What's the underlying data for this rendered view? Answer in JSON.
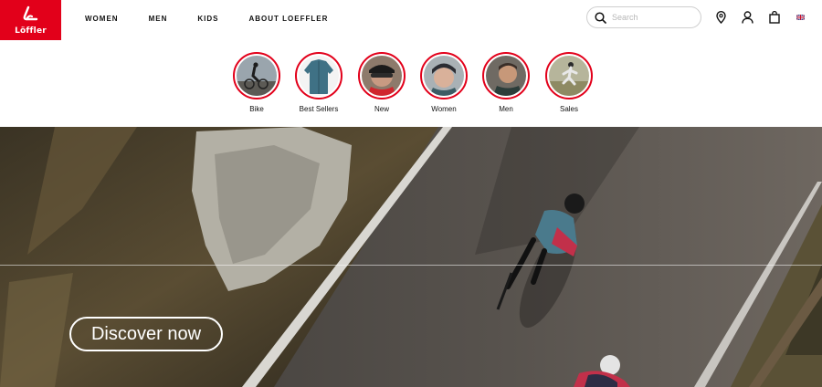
{
  "brand": {
    "logo_text": "Löffler",
    "brand_color": "#e2001a"
  },
  "nav": {
    "items": [
      {
        "label": "WOMEN"
      },
      {
        "label": "MEN"
      },
      {
        "label": "KIDS"
      },
      {
        "label": "ABOUT LOEFFLER"
      }
    ]
  },
  "search": {
    "placeholder": "Search",
    "value": ""
  },
  "header_icons": [
    "store-locator-icon",
    "account-icon",
    "cart-icon",
    "language-flag-uk-icon"
  ],
  "categories": [
    {
      "label": "Bike"
    },
    {
      "label": "Best Sellers"
    },
    {
      "label": "New"
    },
    {
      "label": "Women"
    },
    {
      "label": "Men"
    },
    {
      "label": "Sales"
    }
  ],
  "hero": {
    "cta_label": "Discover now"
  }
}
